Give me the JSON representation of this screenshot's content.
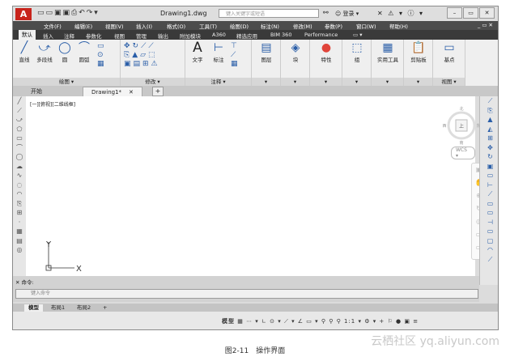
{
  "app": {
    "title": "Drawing1.dwg",
    "search_placeholder": "键入关键字或短语",
    "login": "登录"
  },
  "menu": [
    "文件(F)",
    "编辑(E)",
    "视图(V)",
    "插入(I)",
    "格式(O)",
    "工具(T)",
    "绘图(D)",
    "标注(N)",
    "修改(M)",
    "参数(P)",
    "窗口(W)",
    "帮助(H)"
  ],
  "ribbon_tabs": [
    "默认",
    "插入",
    "注释",
    "参数化",
    "视图",
    "管理",
    "输出",
    "附加模块",
    "A360",
    "精选应用",
    "BIM 360",
    "Performance"
  ],
  "ribbon": {
    "draw": {
      "label": "绘图 ▾",
      "tools": [
        "直线",
        "多段线",
        "圆",
        "圆弧"
      ]
    },
    "modify": {
      "label": "修改 ▾"
    },
    "annotation": {
      "label": "注释 ▾",
      "tools": [
        "文字",
        "标注"
      ]
    },
    "layers": {
      "label": "图层"
    },
    "block": {
      "label": "块"
    },
    "properties": {
      "label": "特性"
    },
    "groups": {
      "label": "组"
    },
    "utilities": {
      "label": "实用工具"
    },
    "clipboard": {
      "label": "剪贴板"
    },
    "base": {
      "label": "基点"
    },
    "view": {
      "label": "视图 ▾"
    }
  },
  "doc_tabs": [
    "开始",
    "Drawing1*"
  ],
  "viewport": {
    "label": "[一][俯视][二维线框]",
    "compass": {
      "n": "北",
      "s": "南",
      "w": "西",
      "e": "东",
      "center": "上"
    },
    "wcs": "WCS ▾"
  },
  "axes": {
    "x": "X",
    "y": "Y"
  },
  "command": {
    "history": "命令:",
    "placeholder": "键入命令"
  },
  "layout_tabs": [
    "模型",
    "布局1",
    "布局2"
  ],
  "status": {
    "model": "模型",
    "scale": "1:1 ▾"
  },
  "caption": "图2-11　操作界面",
  "watermark": "云栖社区 yq.aliyun.com"
}
